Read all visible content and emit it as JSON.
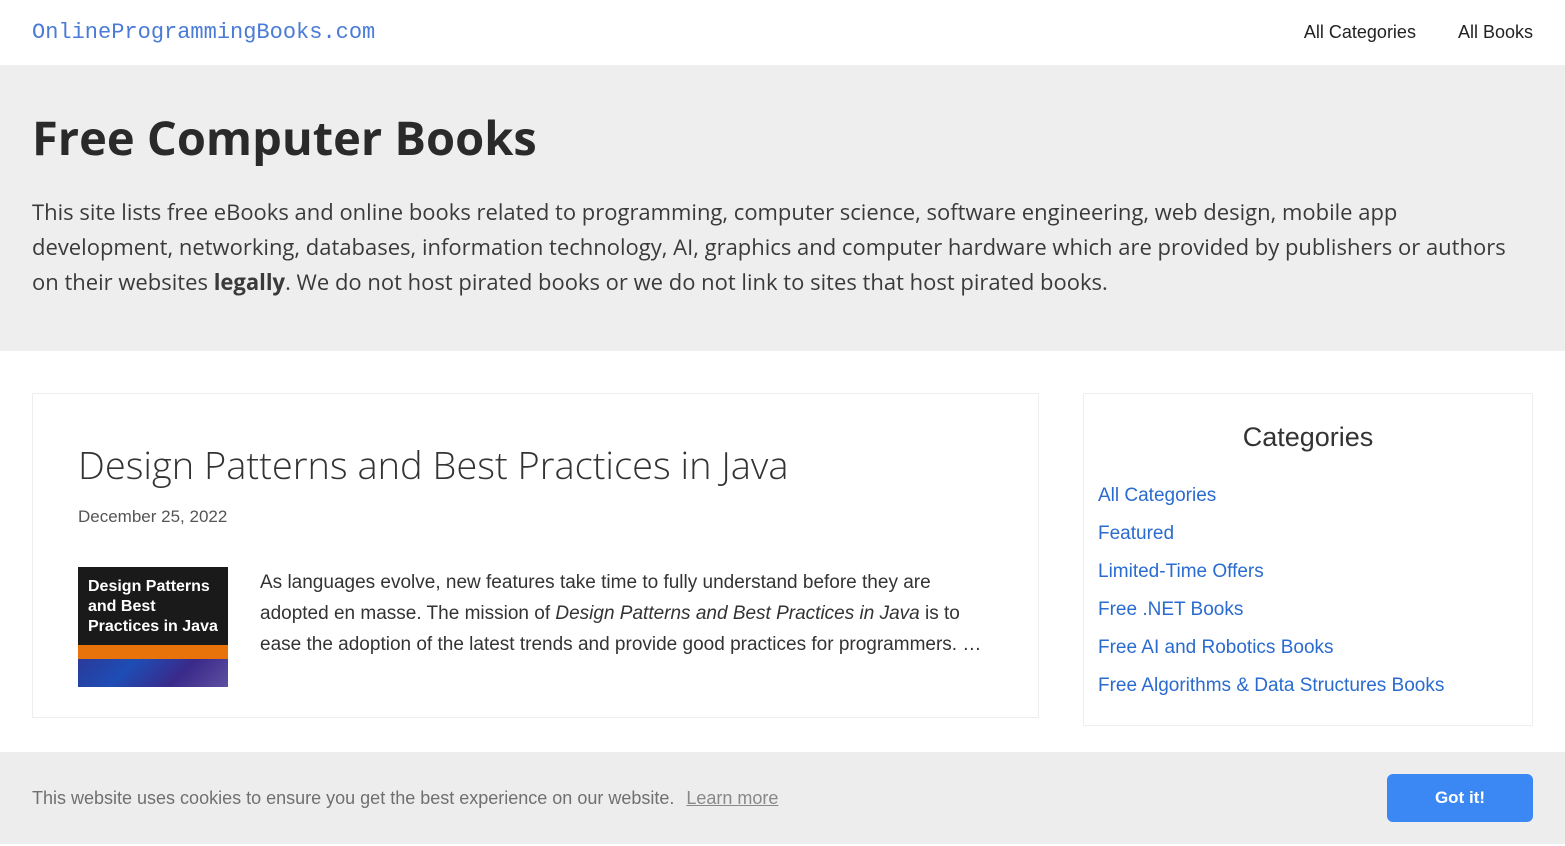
{
  "header": {
    "logo": "OnlineProgrammingBooks.com",
    "nav": {
      "categories": "All Categories",
      "books": "All Books"
    }
  },
  "hero": {
    "title": "Free Computer Books",
    "intro_before": "This site lists free eBooks and online books related to programming, computer science, software engineering, web design, mobile app development, networking, databases, information technology, AI, graphics and computer hardware which are provided by publishers or authors on their websites ",
    "intro_bold": "legally",
    "intro_after": ". We do not host pirated books or we do not link to sites that host pirated books."
  },
  "post": {
    "title": "Design Patterns and Best Practices in Java",
    "date": "December 25, 2022",
    "cover_title": "Design Patterns and Best Practices in Java",
    "body_before": "As languages evolve, new features take time to fully understand before they are adopted en masse. The mission of ",
    "body_italic": "Design Patterns and Best Practices in Java",
    "body_after": " is to ease the adoption of the latest trends and provide good practices for programmers. …"
  },
  "sidebar": {
    "title": "Categories",
    "items": [
      "All Categories",
      "Featured",
      "Limited-Time Offers",
      "Free .NET Books",
      "Free AI and Robotics Books",
      "Free Algorithms & Data Structures Books"
    ]
  },
  "cookie": {
    "message": "This website uses cookies to ensure you get the best experience on our website.",
    "learn": "Learn more",
    "button": "Got it!"
  }
}
